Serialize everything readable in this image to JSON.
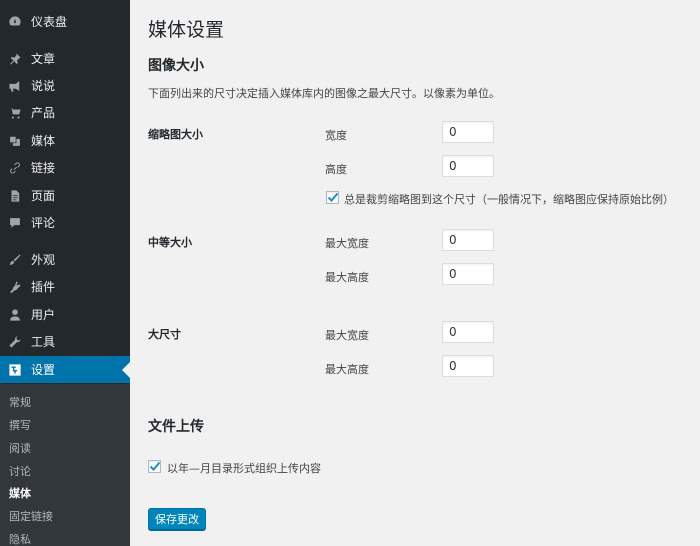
{
  "sidebar": {
    "items": [
      {
        "label": "仪表盘",
        "icon": "dashboard-icon"
      },
      {
        "label": "文章",
        "icon": "pushpin-icon"
      },
      {
        "label": "说说",
        "icon": "megaphone-icon"
      },
      {
        "label": "产品",
        "icon": "cart-icon"
      },
      {
        "label": "媒体",
        "icon": "media-icon"
      },
      {
        "label": "链接",
        "icon": "link-icon"
      },
      {
        "label": "页面",
        "icon": "page-icon"
      },
      {
        "label": "评论",
        "icon": "comment-icon"
      },
      {
        "label": "外观",
        "icon": "paintbrush-icon"
      },
      {
        "label": "插件",
        "icon": "plugin-icon"
      },
      {
        "label": "用户",
        "icon": "user-icon"
      },
      {
        "label": "工具",
        "icon": "wrench-icon"
      },
      {
        "label": "设置",
        "icon": "settings-icon"
      }
    ],
    "submenu": [
      "常规",
      "撰写",
      "阅读",
      "讨论",
      "媒体",
      "固定链接",
      "隐私"
    ],
    "active_item": "设置",
    "current_submenu": "媒体"
  },
  "main": {
    "page_title": "媒体设置",
    "image_sizes": {
      "title": "图像大小",
      "description": "下面列出来的尺寸决定插入媒体库内的图像之最大尺寸。以像素为单位。",
      "thumbnail": {
        "label": "缩略图大小",
        "width_label": "宽度",
        "width_value": "0",
        "height_label": "高度",
        "height_value": "0",
        "crop_label": "总是裁剪缩略图到这个尺寸（一般情况下，缩略图应保持原始比例）",
        "crop_checked": true
      },
      "medium": {
        "label": "中等大小",
        "max_width_label": "最大宽度",
        "max_width_value": "0",
        "max_height_label": "最大高度",
        "max_height_value": "0"
      },
      "large": {
        "label": "大尺寸",
        "max_width_label": "最大宽度",
        "max_width_value": "0",
        "max_height_label": "最大高度",
        "max_height_value": "0"
      }
    },
    "uploads": {
      "title": "文件上传",
      "organize_label": "以年—月目录形式组织上传内容",
      "organize_checked": true
    },
    "save_label": "保存更改"
  },
  "colors": {
    "sidebar_bg": "#23282d",
    "submenu_bg": "#32373c",
    "accent": "#0073aa",
    "button": "#0085ba",
    "content_bg": "#f1f1f1"
  }
}
